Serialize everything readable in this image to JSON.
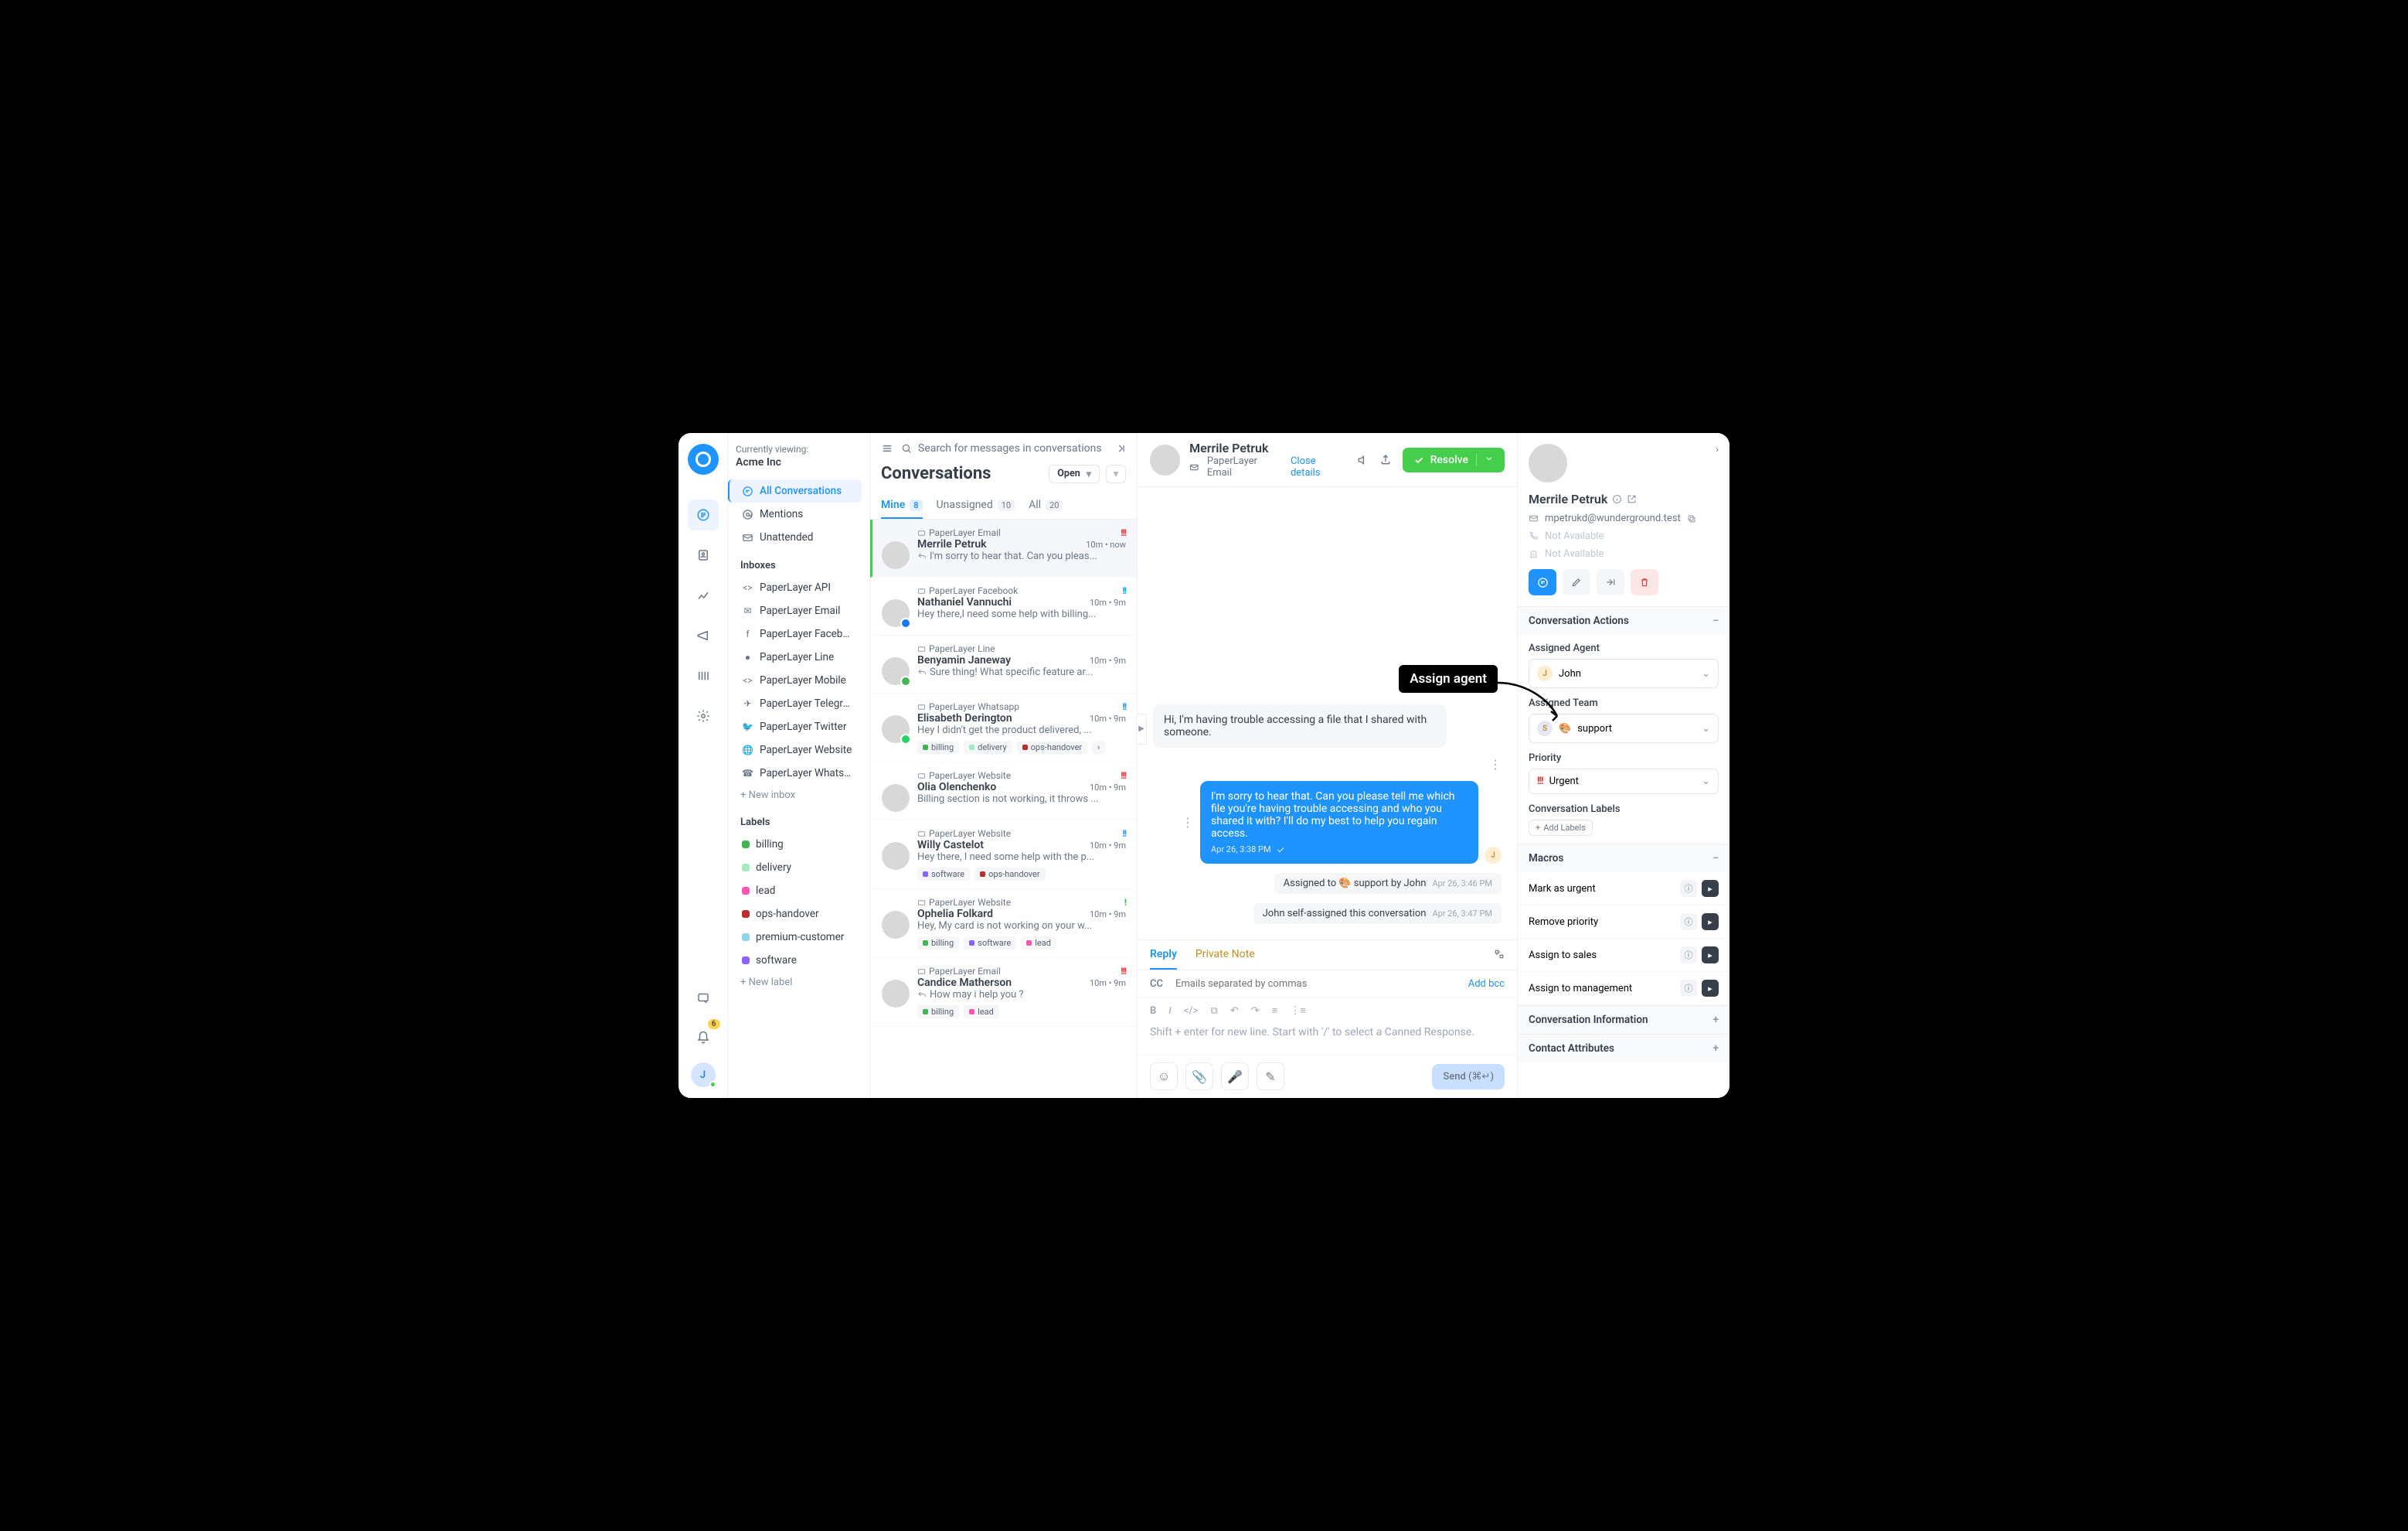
{
  "org": {
    "viewing_label": "Currently viewing:",
    "name": "Acme Inc"
  },
  "search": {
    "placeholder": "Search for messages in conversations"
  },
  "notifications": {
    "count": "6"
  },
  "user_initial": "J",
  "sidebar": {
    "items": [
      {
        "label": "All Conversations",
        "active": true
      },
      {
        "label": "Mentions"
      },
      {
        "label": "Unattended"
      }
    ],
    "inboxes_title": "Inboxes",
    "inboxes": [
      "PaperLayer API",
      "PaperLayer Email",
      "PaperLayer Facebo...",
      "PaperLayer Line",
      "PaperLayer Mobile",
      "PaperLayer Telegram",
      "PaperLayer Twitter",
      "PaperLayer Website",
      "PaperLayer Whatsa..."
    ],
    "new_inbox": "New inbox",
    "labels_title": "Labels",
    "labels": [
      {
        "name": "billing",
        "color": "#44b556"
      },
      {
        "name": "delivery",
        "color": "#a4e9c0"
      },
      {
        "name": "lead",
        "color": "#ff56b1"
      },
      {
        "name": "ops-handover",
        "color": "#b92f2f"
      },
      {
        "name": "premium-customer",
        "color": "#8fd6ed"
      },
      {
        "name": "software",
        "color": "#8a63ff"
      }
    ],
    "new_label": "New label"
  },
  "conversations": {
    "title": "Conversations",
    "filter": "Open",
    "tabs": [
      {
        "label": "Mine",
        "count": "8",
        "active": true
      },
      {
        "label": "Unassigned",
        "count": "10"
      },
      {
        "label": "All",
        "count": "20"
      }
    ],
    "items": [
      {
        "channel": "PaperLayer Email",
        "name": "Merrile Petruk",
        "time": "10m • now",
        "preview": "I'm sorry to hear that. Can you pleas...",
        "reply": true,
        "priority": "high",
        "active": true
      },
      {
        "channel": "PaperLayer Facebook",
        "name": "Nathaniel Vannuchi",
        "time": "10m • 9m",
        "preview": "Hey there,I need some help with billing...",
        "priority": "med",
        "chan_color": "#1877f2"
      },
      {
        "channel": "PaperLayer Line",
        "name": "Benyamin Janeway",
        "time": "10m • 9m",
        "preview": "Sure thing! What specific feature ar...",
        "reply": true,
        "chan_color": "#44b556"
      },
      {
        "channel": "PaperLayer Whatsapp",
        "name": "Elisabeth Derington",
        "time": "10m • 9m",
        "preview": "Hey I didn't get the product delivered, ...",
        "priority": "med",
        "labels": [
          [
            "billing",
            "#44b556"
          ],
          [
            "delivery",
            "#a4e9c0"
          ],
          [
            "ops-handover",
            "#b92f2f"
          ]
        ],
        "more_labels": true,
        "chan_color": "#25d366"
      },
      {
        "channel": "PaperLayer Website",
        "name": "Olia Olenchenko",
        "time": "10m • 9m",
        "preview": "Billing section is not working, it throws ...",
        "priority": "high"
      },
      {
        "channel": "PaperLayer Website",
        "name": "Willy Castelot",
        "time": "10m • 9m",
        "preview": "Hey there, I need some help with the p...",
        "priority": "med",
        "labels": [
          [
            "software",
            "#8a63ff"
          ],
          [
            "ops-handover",
            "#b92f2f"
          ]
        ]
      },
      {
        "channel": "PaperLayer Website",
        "name": "Ophelia Folkard",
        "time": "10m • 9m",
        "preview": "Hey, My card is not working on your w...",
        "priority": "low",
        "labels": [
          [
            "billing",
            "#44b556"
          ],
          [
            "software",
            "#8a63ff"
          ],
          [
            "lead",
            "#ff56b1"
          ]
        ]
      },
      {
        "channel": "PaperLayer Email",
        "name": "Candice Matherson",
        "time": "10m • 9m",
        "preview": "How may i help you ?",
        "reply": true,
        "priority": "high",
        "labels": [
          [
            "billing",
            "#44b556"
          ],
          [
            "lead",
            "#ff56b1"
          ]
        ]
      }
    ]
  },
  "chat": {
    "contact_name": "Merrile Petruk",
    "inbox": "PaperLayer Email",
    "close_details": "Close details",
    "resolve_label": "Resolve",
    "messages": {
      "incoming": "Hi, I'm having trouble accessing a file that I shared with someone.",
      "outgoing": "I'm sorry to hear that. Can you please tell me which file you're having trouble accessing and who you shared it with? I'll do my best to help you regain access.",
      "outgoing_time": "Apr 26, 3:38 PM",
      "system1": "Assigned to 🎨 support by John",
      "system1_time": "Apr 26, 3:46 PM",
      "system2": "John self-assigned this conversation",
      "system2_time": "Apr 26, 3:47 PM"
    },
    "reply_tabs": {
      "reply": "Reply",
      "note": "Private Note"
    },
    "cc_label": "CC",
    "cc_placeholder": "Emails separated by commas",
    "bcc": "Add bcc",
    "editor_placeholder": "Shift + enter for new line. Start with '/' to select a Canned Response.",
    "send_label": "Send (⌘↵)"
  },
  "details": {
    "name": "Merrile Petruk",
    "email": "mpetrukd@wunderground.test",
    "phone": "Not Available",
    "company": "Not Available",
    "sections": {
      "actions": "Conversation Actions",
      "assigned_agent": "Assigned Agent",
      "agent_value": "John",
      "assigned_team": "Assigned Team",
      "team_value": "support",
      "priority": "Priority",
      "priority_value": "Urgent",
      "labels": "Conversation Labels",
      "add_labels": "Add Labels",
      "macros": "Macros",
      "macro_list": [
        "Mark as urgent",
        "Remove priority",
        "Assign to sales",
        "Assign to management"
      ],
      "info": "Conversation Information",
      "attrs": "Contact Attributes"
    }
  },
  "callout": "Assign agent"
}
